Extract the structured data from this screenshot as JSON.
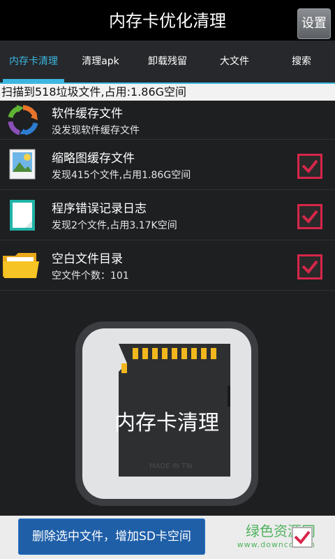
{
  "titlebar": {
    "title": "内存卡优化清理",
    "settings_label": "设置"
  },
  "tabs": [
    {
      "label": "内存卡清理",
      "active": true
    },
    {
      "label": "清理apk",
      "active": false
    },
    {
      "label": "卸载残留",
      "active": false
    },
    {
      "label": "大文件",
      "active": false
    },
    {
      "label": "搜索",
      "active": false
    }
  ],
  "summary": {
    "text": "扫描到518垃圾文件,占用:1.86G空间"
  },
  "items": [
    {
      "title": "软件缓存文件",
      "subtitle": "没发现软件缓存文件",
      "icon": "refresh-cycle-icon",
      "checked": false,
      "show_check": false
    },
    {
      "title": "缩略图缓存文件",
      "subtitle": "发现415个文件,占用1.86G空间",
      "icon": "picture-icon",
      "checked": true,
      "show_check": true
    },
    {
      "title": "程序错误记录日志",
      "subtitle": "发现2个文件,占用3.17K空间",
      "icon": "document-icon",
      "checked": true,
      "show_check": true
    },
    {
      "title": "空白文件目录",
      "subtitle": "空文件个数：101",
      "icon": "folder-icon",
      "checked": true,
      "show_check": true
    }
  ],
  "main_button": {
    "label": "内存卡清理",
    "sd_text": "MADE IN TW"
  },
  "bottom": {
    "delete_label": "删除选中文件，增加SD卡空间",
    "watermark_title": "绿色资源网",
    "watermark_sub": "www.downcc.com"
  },
  "colors": {
    "accent": "#3cb6e0",
    "check_red": "#d7264a",
    "button_blue": "#1f5fa8"
  }
}
